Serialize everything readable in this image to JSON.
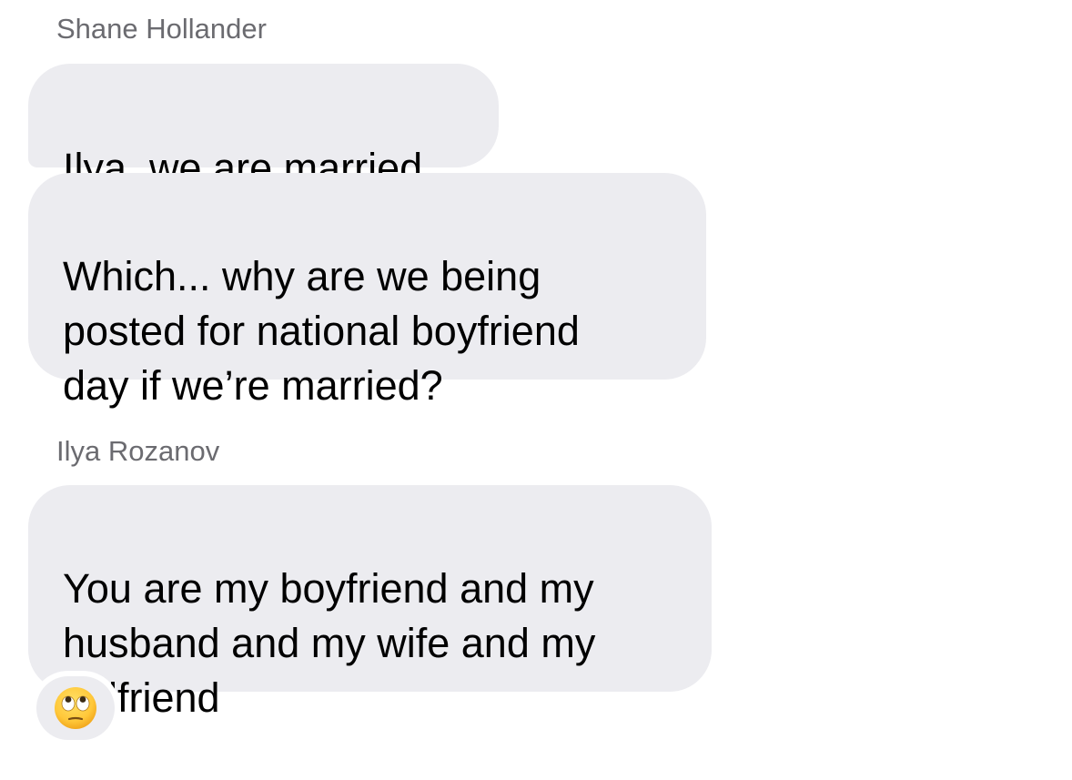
{
  "messages": [
    {
      "sender": "Shane Hollander",
      "bubbles": [
        "Ilya, we are married",
        "Which... why are we being\nposted for national boyfriend\nday if we’re married?"
      ]
    },
    {
      "sender": "Ilya Rozanov",
      "bubbles": [
        "You are my boyfriend and my\nhusband and my wife and my\ngirlfriend"
      ],
      "reaction": {
        "icon": "eye-roll-emoji-icon"
      }
    }
  ],
  "colors": {
    "bubble_background": "#ececf0",
    "sender_text": "#6b6b70",
    "message_text": "#000000",
    "emoji_face": "#ffca3a"
  }
}
